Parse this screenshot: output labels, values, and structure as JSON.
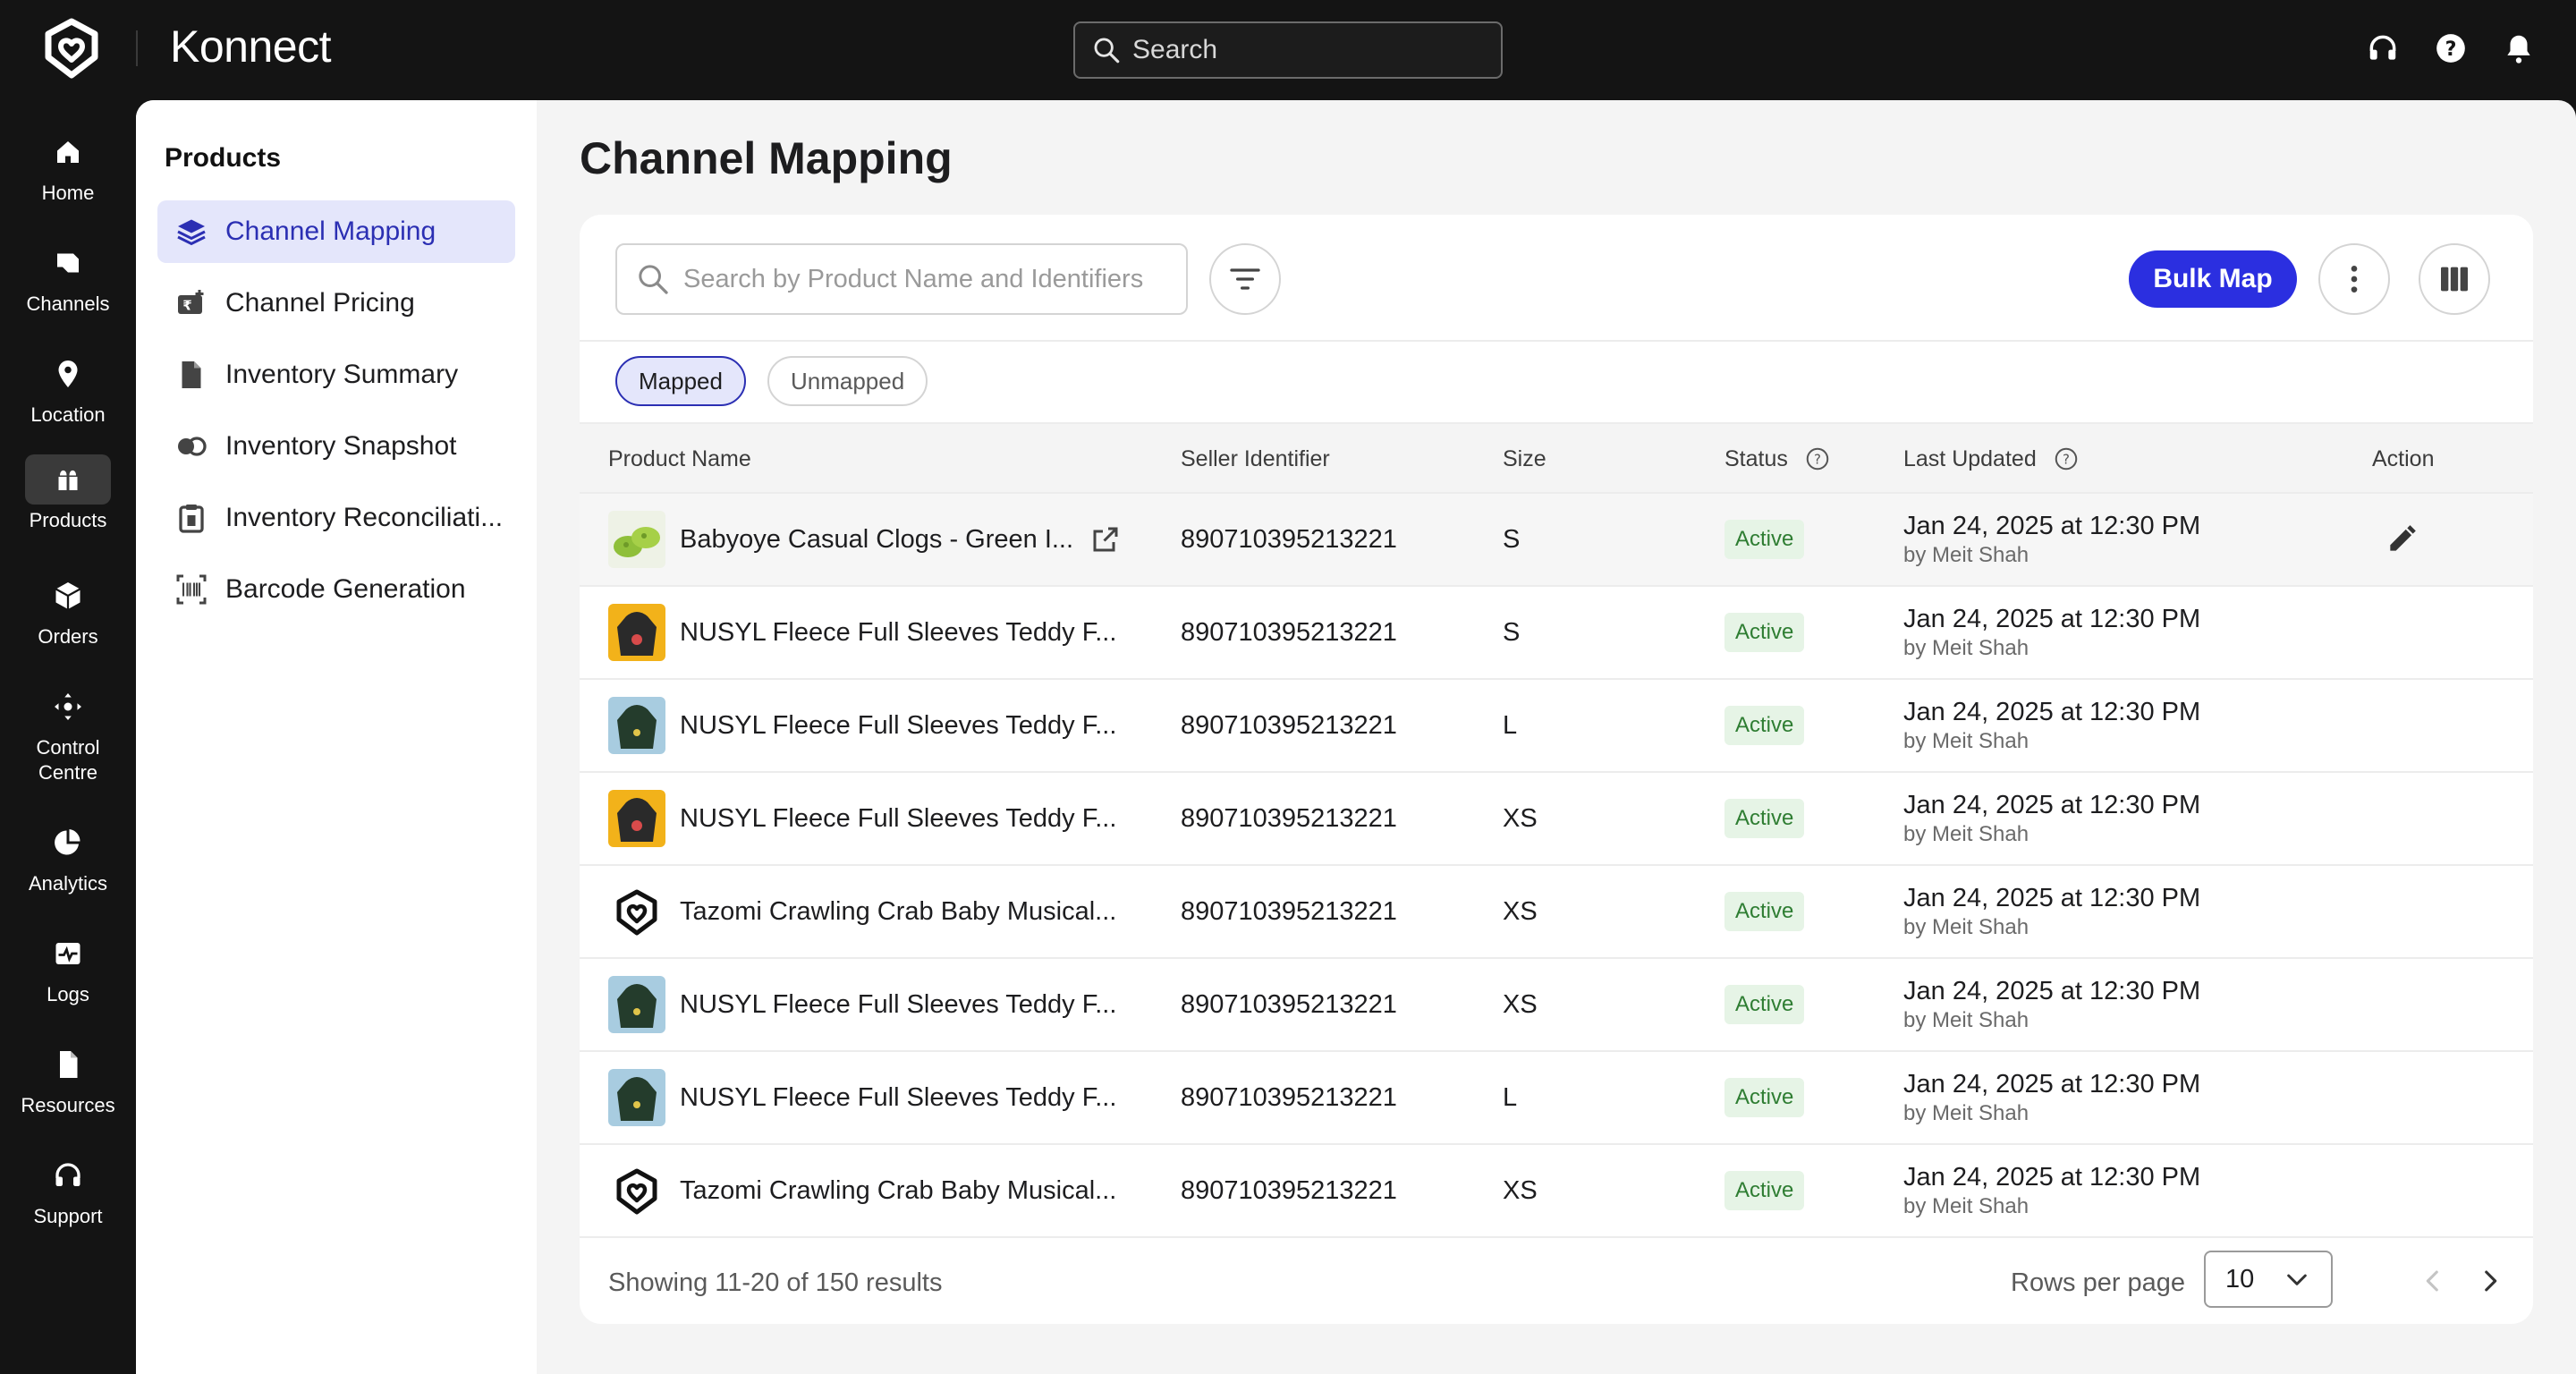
{
  "app": {
    "brand": "Konnect",
    "search_placeholder": "Search",
    "top_icons": [
      "headset-icon",
      "help-icon",
      "bell-icon"
    ]
  },
  "rail": [
    {
      "label": "Home",
      "icon": "home-icon"
    },
    {
      "label": "Channels",
      "icon": "channels-icon"
    },
    {
      "label": "Location",
      "icon": "location-icon"
    },
    {
      "label": "Products",
      "icon": "products-icon",
      "active": true
    },
    {
      "label": "Orders",
      "icon": "orders-icon"
    },
    {
      "label": "Control\nCentre",
      "icon": "control-centre-icon"
    },
    {
      "label": "Analytics",
      "icon": "analytics-icon"
    },
    {
      "label": "Logs",
      "icon": "logs-icon"
    },
    {
      "label": "Resources",
      "icon": "resources-icon"
    },
    {
      "label": "Support",
      "icon": "support-icon"
    }
  ],
  "subnav": {
    "title": "Products",
    "items": [
      {
        "label": "Channel Mapping",
        "icon": "layers-icon",
        "active": true
      },
      {
        "label": "Channel Pricing",
        "icon": "pricing-icon"
      },
      {
        "label": "Inventory Summary",
        "icon": "document-icon"
      },
      {
        "label": "Inventory Snapshot",
        "icon": "snapshot-icon"
      },
      {
        "label": "Inventory Reconciliati...",
        "icon": "clipboard-icon"
      },
      {
        "label": "Barcode Generation",
        "icon": "barcode-icon"
      }
    ]
  },
  "page": {
    "title": "Channel Mapping",
    "search_placeholder": "Search by Product Name and Identifiers",
    "bulk_map_label": "Bulk Map",
    "tabs": [
      {
        "label": "Mapped",
        "active": true
      },
      {
        "label": "Unmapped"
      }
    ]
  },
  "table": {
    "headers": {
      "product": "Product Name",
      "seller": "Seller Identifier",
      "size": "Size",
      "status": "Status",
      "updated": "Last Updated",
      "action": "Action"
    },
    "rows": [
      {
        "name": "Babyoye Casual Clogs - Green I...",
        "seller_id": "890710395213221",
        "size": "S",
        "status": "Active",
        "date": "Jan 24, 2025 at 12:30 PM",
        "by": "by Meit Shah",
        "thumb": "clogs"
      },
      {
        "name": "NUSYL Fleece Full Sleeves Teddy F...",
        "seller_id": "890710395213221",
        "size": "S",
        "status": "Active",
        "date": "Jan 24, 2025 at 12:30 PM",
        "by": "by Meit Shah",
        "thumb": "hoodie-yellow"
      },
      {
        "name": "NUSYL Fleece Full Sleeves Teddy F...",
        "seller_id": "890710395213221",
        "size": "L",
        "status": "Active",
        "date": "Jan 24, 2025 at 12:30 PM",
        "by": "by Meit Shah",
        "thumb": "hoodie-blue"
      },
      {
        "name": "NUSYL Fleece Full Sleeves Teddy F...",
        "seller_id": "890710395213221",
        "size": "XS",
        "status": "Active",
        "date": "Jan 24, 2025 at 12:30 PM",
        "by": "by Meit Shah",
        "thumb": "hoodie-yellow"
      },
      {
        "name": "Tazomi Crawling Crab Baby Musical...",
        "seller_id": "890710395213221",
        "size": "XS",
        "status": "Active",
        "date": "Jan 24, 2025 at 12:30 PM",
        "by": "by Meit Shah",
        "thumb": "logo"
      },
      {
        "name": "NUSYL Fleece Full Sleeves Teddy F...",
        "seller_id": "890710395213221",
        "size": "XS",
        "status": "Active",
        "date": "Jan 24, 2025 at 12:30 PM",
        "by": "by Meit Shah",
        "thumb": "hoodie-blue"
      },
      {
        "name": "NUSYL Fleece Full Sleeves Teddy F...",
        "seller_id": "890710395213221",
        "size": "L",
        "status": "Active",
        "date": "Jan 24, 2025 at 12:30 PM",
        "by": "by Meit Shah",
        "thumb": "hoodie-blue"
      },
      {
        "name": "Tazomi Crawling Crab Baby Musical...",
        "seller_id": "890710395213221",
        "size": "XS",
        "status": "Active",
        "date": "Jan 24, 2025 at 12:30 PM",
        "by": "by Meit Shah",
        "thumb": "logo"
      }
    ]
  },
  "footer": {
    "showing": "Showing 11-20 of 150 results",
    "rows_per_page_label": "Rows per page",
    "rows_per_page_value": "10"
  },
  "colors": {
    "accent": "#2b2fe0",
    "active_badge_bg": "#e6f4e6",
    "active_badge_text": "#2e7d32",
    "nav_bg": "#141414"
  }
}
